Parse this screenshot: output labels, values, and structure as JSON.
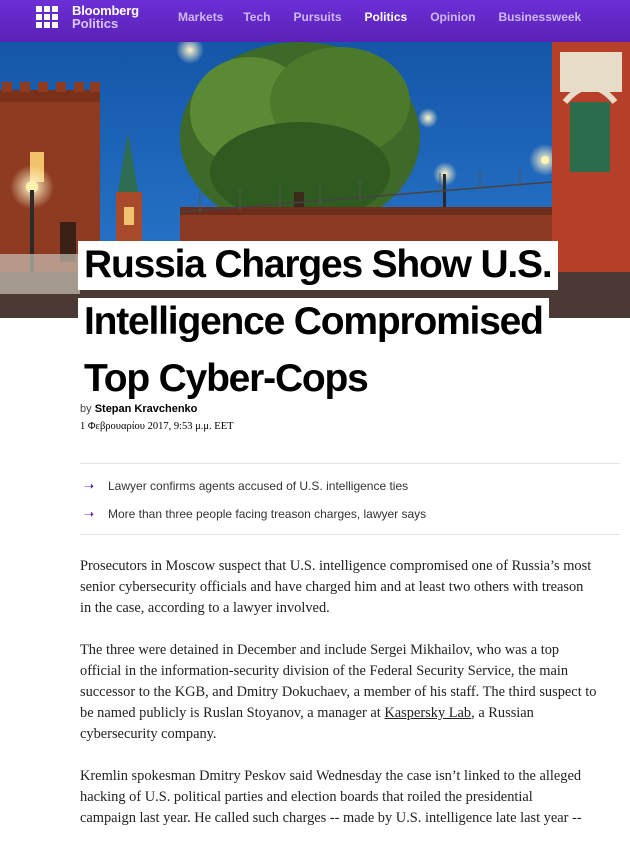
{
  "brand": {
    "name": "Bloomberg",
    "section": "Politics"
  },
  "nav": {
    "items": [
      {
        "label": "Markets",
        "active": false
      },
      {
        "label": "Tech",
        "active": false
      },
      {
        "label": "Pursuits",
        "active": false
      },
      {
        "label": "Politics",
        "active": true
      },
      {
        "label": "Opinion",
        "active": false
      },
      {
        "label": "Businessweek",
        "active": false
      }
    ]
  },
  "colors": {
    "nav_bg": "#5b21b6",
    "accent": "#5b21b6"
  },
  "headline": {
    "line1": "Russia Charges Show U.S.",
    "line2": "Intelligence Compromised",
    "line3": "Top Cyber-Cops"
  },
  "byline": {
    "prefix": "by",
    "author": "Stepan Kravchenko"
  },
  "dateline": "1 Φεβρουαρίου 2017, 9:53 μ.μ. EET",
  "summary": [
    "Lawyer confirms agents accused of U.S. intelligence ties",
    "More than three people facing treason charges, lawyer says"
  ],
  "body": {
    "p1": [
      "Prosecutors in Moscow suspect that U.S. intelligence compromised one of Russia’s most",
      "senior cybersecurity officials and have charged him and at least two others with treason",
      "in the case, according to a lawyer involved."
    ],
    "p2": [
      "The three were detained in December and include Sergei Mikhailov, who was a top",
      "official in the information-security division of the Federal Security Service, the main",
      "successor to the KGB, and Dmitry Dokuchaev, a member of his staff. The third suspect to",
      "be named publicly is Ruslan Stoyanov, a manager at ",
      "Kaspersky Lab",
      ", a Russian",
      "cybersecurity company."
    ],
    "p3": [
      "Kremlin spokesman Dmitry Peskov said Wednesday the case isn’t linked to the alleged",
      "hacking of U.S. political parties and election boards that roiled the presidential",
      "campaign last year. He called such charges -- made by U.S. intelligence late last year --"
    ]
  }
}
